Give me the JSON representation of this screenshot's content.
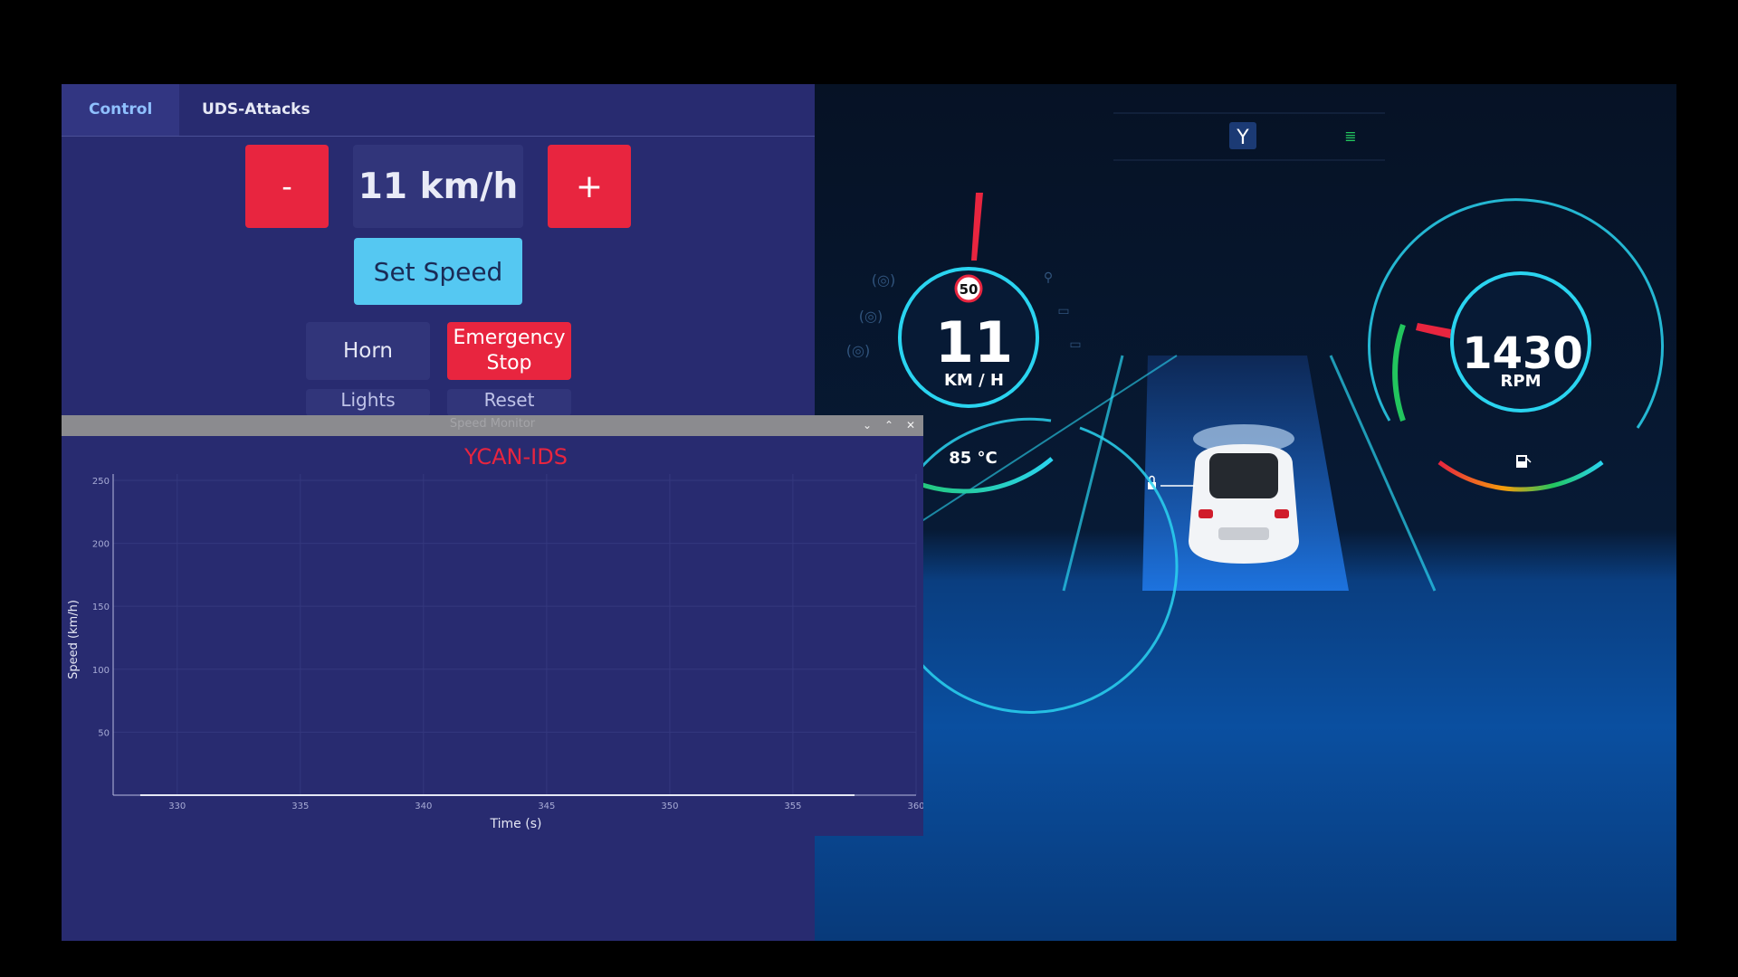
{
  "tabs": [
    {
      "label": "Control",
      "active": true
    },
    {
      "label": "UDS-Attacks",
      "active": false
    }
  ],
  "control": {
    "minus_label": "-",
    "plus_label": "+",
    "speed_display": "11 km/h",
    "set_speed_label": "Set Speed",
    "horn_label": "Horn",
    "emergency_stop_label": "Emergency Stop",
    "lights_label": "Lights",
    "reset_label": "Reset"
  },
  "speed_monitor": {
    "window_title": "Speed Monitor",
    "watermark": "YCAN-IDS",
    "chart_data": {
      "type": "line",
      "xlabel": "Time (s)",
      "ylabel": "Speed (km/h)",
      "x_ticks": [
        "330",
        "335",
        "340",
        "345",
        "350",
        "355",
        "360"
      ],
      "y_ticks": [
        "50",
        "100",
        "150",
        "200",
        "250"
      ],
      "xlim": [
        327.4,
        360
      ],
      "ylim": [
        0,
        255
      ],
      "series": [
        {
          "x": [
            328.5,
            331,
            334,
            337,
            340,
            343,
            346,
            349,
            352,
            355,
            357.5
          ],
          "y": [
            0,
            0,
            0,
            0,
            0,
            0,
            0,
            0,
            0,
            0,
            0
          ]
        }
      ],
      "grid": true
    }
  },
  "dashboard": {
    "speed_value": "11",
    "speed_unit": "KM / H",
    "speed_limit": "50",
    "temperature": "85 °C",
    "rpm_value": "1430",
    "rpm_unit": "RPM",
    "accent_color": "#2ad4f0",
    "needle_color": "#e8253f"
  }
}
